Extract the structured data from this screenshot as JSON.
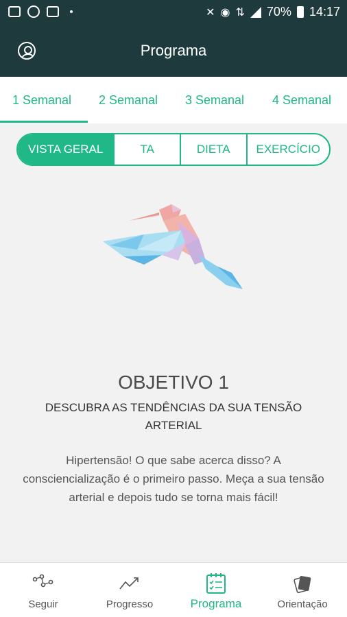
{
  "status_bar": {
    "battery": "70%",
    "time": "14:17"
  },
  "app_bar": {
    "title": "Programa"
  },
  "week_tabs": [
    {
      "label": "1 Semanal",
      "active": true
    },
    {
      "label": "2 Semanal",
      "active": false
    },
    {
      "label": "3 Semanal",
      "active": false
    },
    {
      "label": "4 Semanal",
      "active": false
    }
  ],
  "segments": [
    {
      "label": "VISTA GERAL",
      "active": true
    },
    {
      "label": "TA",
      "active": false
    },
    {
      "label": "DIETA",
      "active": false
    },
    {
      "label": "EXERCÍCIO",
      "active": false
    }
  ],
  "content": {
    "illustration": "hummingbird",
    "title": "OBJETIVO 1",
    "subtitle": "DESCUBRA AS TENDÊNCIAS DA SUA TENSÃO ARTERIAL",
    "body": "Hipertensão! O que sabe acerca disso? A consciencialização é o primeiro passo. Meça a sua tensão arterial e depois tudo se torna mais fácil!"
  },
  "bottom_nav": [
    {
      "label": "Seguir",
      "icon": "track-icon",
      "active": false
    },
    {
      "label": "Progresso",
      "icon": "progress-icon",
      "active": false
    },
    {
      "label": "Programa",
      "icon": "program-icon",
      "active": true
    },
    {
      "label": "Orientação",
      "icon": "guidance-icon",
      "active": false
    }
  ],
  "colors": {
    "header": "#1e3a3c",
    "accent": "#1fb886",
    "background": "#f2f2f2"
  }
}
